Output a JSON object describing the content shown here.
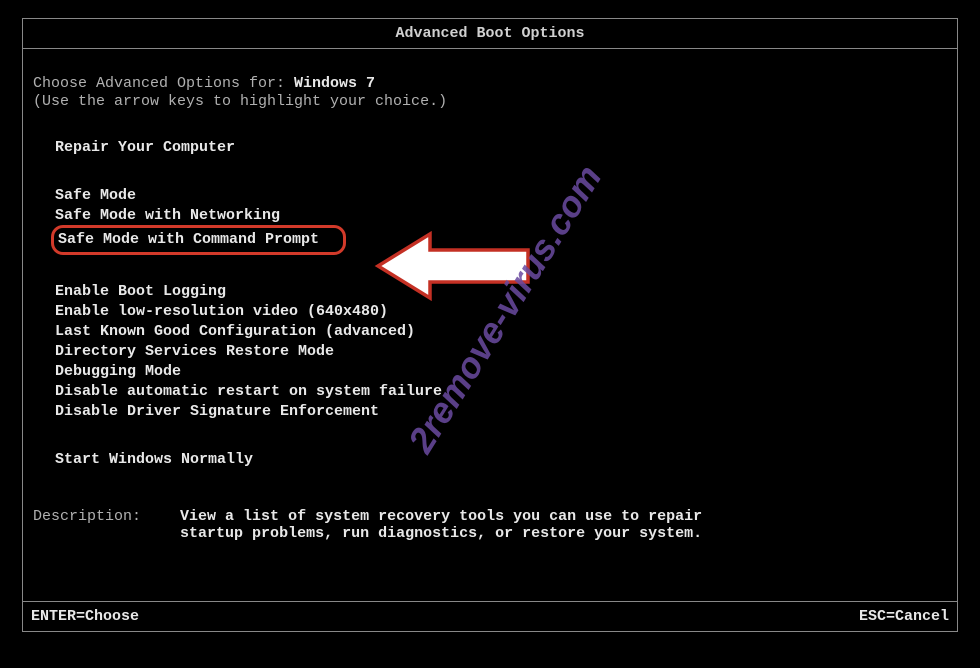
{
  "title": "Advanced Boot Options",
  "prompt_prefix": "Choose Advanced Options for: ",
  "os_name": "Windows 7",
  "hint": "(Use the arrow keys to highlight your choice.)",
  "groups": {
    "repair": {
      "label": "Repair Your Computer"
    },
    "safe": {
      "mode": "Safe Mode",
      "networking": "Safe Mode with Networking",
      "cmd": "Safe Mode with Command Prompt"
    },
    "advanced": {
      "boot_logging": "Enable Boot Logging",
      "low_res": "Enable low-resolution video (640x480)",
      "lkgc": "Last Known Good Configuration (advanced)",
      "dsrm": "Directory Services Restore Mode",
      "debug": "Debugging Mode",
      "no_auto_restart": "Disable automatic restart on system failure",
      "no_driver_sig": "Disable Driver Signature Enforcement"
    },
    "normal": {
      "label": "Start Windows Normally"
    }
  },
  "description": {
    "label": "Description:",
    "text": "View a list of system recovery tools you can use to repair startup problems, run diagnostics, or restore your system."
  },
  "footer": {
    "enter": "ENTER=Choose",
    "esc": "ESC=Cancel"
  },
  "watermark": "2remove-virus.com"
}
